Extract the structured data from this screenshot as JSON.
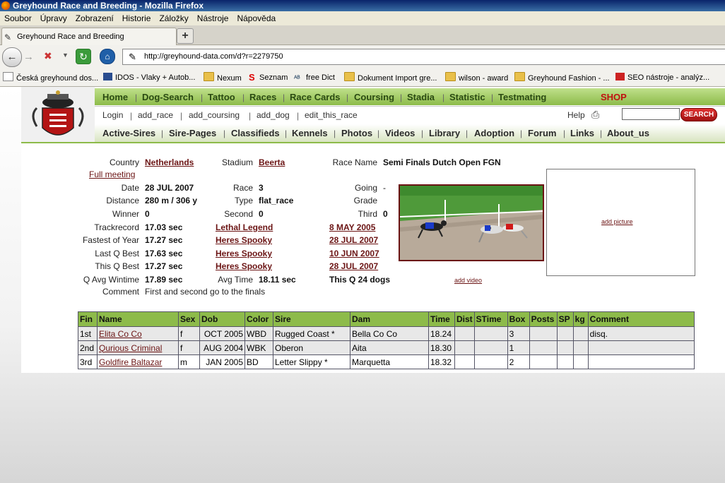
{
  "window": {
    "title": "Greyhound Race and Breeding - Mozilla Firefox"
  },
  "menu": [
    "Soubor",
    "Úpravy",
    "Zobrazení",
    "Historie",
    "Záložky",
    "Nástroje",
    "Nápověda"
  ],
  "tab": {
    "title": "Greyhound Race and Breeding",
    "new_tab": "+"
  },
  "address": {
    "url": "http://greyhound-data.com/d?r=2279750"
  },
  "bookmarks": [
    "Česká greyhound dos...",
    "IDOS - Vlaky + Autob...",
    "Nexum",
    "Seznam",
    "free Dict",
    "Dokument Import gre...",
    "wilson - award",
    "Greyhound Fashion - ...",
    "SEO nástroje - analýz..."
  ],
  "nav_main": [
    "Home",
    "Dog-Search",
    "Tattoo",
    "Races",
    "Race Cards",
    "Coursing",
    "Stadia",
    "Statistic",
    "Testmating"
  ],
  "shop": "SHOP",
  "nav_user": [
    "Login",
    "add_race",
    "add_coursing",
    "add_dog",
    "edit_this_race"
  ],
  "help": "Help",
  "search_button": "SEARCH",
  "nav_secondary": [
    "Active-Sires",
    "Sire-Pages",
    "Classifieds",
    "Kennels",
    "Photos",
    "Videos",
    "Library",
    "Adoption",
    "Forum",
    "Links",
    "About_us"
  ],
  "race": {
    "country_label": "Country",
    "country": "Netherlands",
    "stadium_label": "Stadium",
    "stadium": "Beerta",
    "race_name_label": "Race Name",
    "race_name": "Semi Finals Dutch Open FGN",
    "full_meeting": "Full meeting",
    "date_label": "Date",
    "date": "28 JUL 2007",
    "race_label": "Race",
    "race": "3",
    "going_label": "Going",
    "going": "-",
    "distance_label": "Distance",
    "distance": "280 m / 306 y",
    "type_label": "Type",
    "type": "flat_race",
    "grade_label": "Grade",
    "winner_label": "Winner",
    "winner": "0",
    "second_label": "Second",
    "second": "0",
    "third_label": "Third",
    "third": "0",
    "trackrecord_label": "Trackrecord",
    "trackrecord": "17.03 sec",
    "trackrecord_dog": "Lethal Legend",
    "trackrecord_date": "8 MAY 2005",
    "fastest_label": "Fastest of Year",
    "fastest": "17.27 sec",
    "fastest_dog": "Heres Spooky",
    "fastest_date": "28 JUL 2007",
    "lastq_label": "Last Q Best",
    "lastq": "17.63 sec",
    "lastq_dog": "Heres Spooky",
    "lastq_date": "10 JUN 2007",
    "thisq_label": "This Q Best",
    "thisq": "17.27 sec",
    "thisq_dog": "Heres Spooky",
    "thisq_date": "28 JUL 2007",
    "qavg_label": "Q Avg Wintime",
    "qavg": "17.89 sec",
    "avgtime_label": "Avg Time",
    "avgtime": "18.11 sec",
    "thisq_dogs": "This Q 24 dogs",
    "comment_label": "Comment",
    "comment": "First and second go to the finals",
    "add_video": "add video",
    "add_picture": "add picture"
  },
  "results": {
    "headers": [
      "Fin",
      "Name",
      "Sex",
      "Dob",
      "Color",
      "Sire",
      "Dam",
      "Time",
      "Dist",
      "STime",
      "Box",
      "Posts",
      "SP",
      "kg",
      "Comment"
    ],
    "rows": [
      [
        "1st",
        "Elita Co Co",
        "f",
        "OCT 2005",
        "WBD",
        "Rugged Coast *",
        "Bella Co Co",
        "18.24",
        "",
        "",
        "3",
        "",
        "",
        "",
        "disq."
      ],
      [
        "2nd",
        "Qurious Criminal",
        "f",
        "AUG 2004",
        "WBK",
        "Oberon",
        "Aita",
        "18.30",
        "",
        "",
        "1",
        "",
        "",
        "",
        ""
      ],
      [
        "3rd",
        "Goldfire Baltazar",
        "m",
        "JAN 2005",
        "BD",
        "Letter Slippy *",
        "Marquetta",
        "18.32",
        "",
        "",
        "2",
        "",
        "",
        "",
        ""
      ]
    ]
  }
}
